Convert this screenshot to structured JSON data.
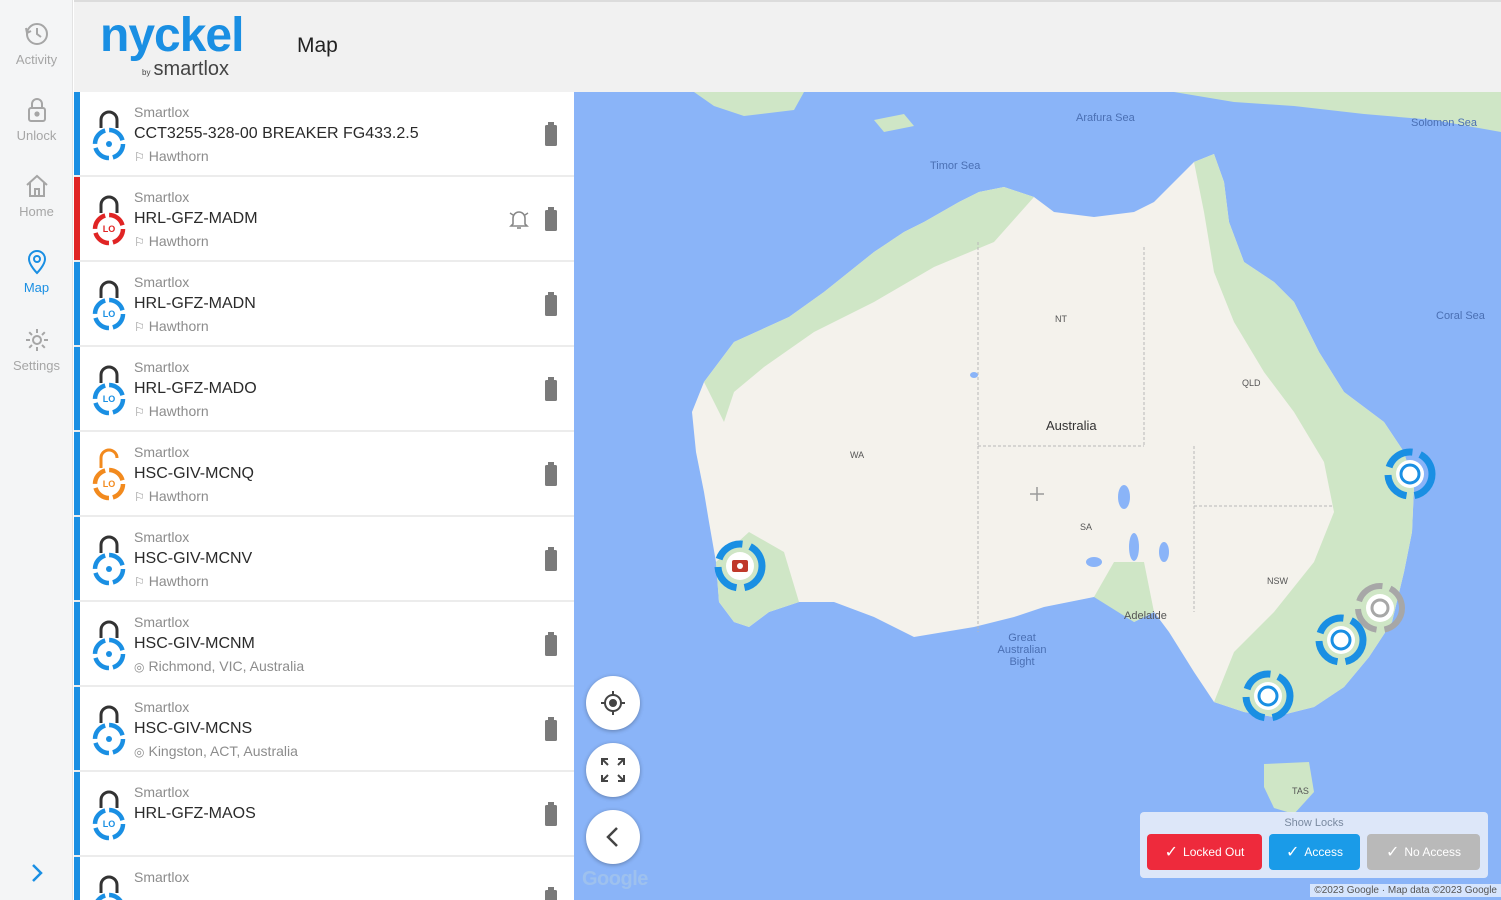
{
  "brand": {
    "name": "nyckel",
    "sub_prefix": "by",
    "sub": "smartlox"
  },
  "page_title": "Map",
  "nav": [
    {
      "label": "Activity",
      "icon": "history-icon",
      "active": false
    },
    {
      "label": "Unlock",
      "icon": "lock-icon",
      "active": false
    },
    {
      "label": "Home",
      "icon": "home-icon",
      "active": false
    },
    {
      "label": "Map",
      "icon": "map-pin-icon",
      "active": true
    },
    {
      "label": "Settings",
      "icon": "gear-icon",
      "active": false
    }
  ],
  "locks": [
    {
      "vendor": "Smartlox",
      "name": "CCT3255-328-00 BREAKER FG433.2.5",
      "location": "Hawthorn",
      "location_icon": "flag-icon",
      "status": "locked",
      "color": "#1a8fe3",
      "alarm": false
    },
    {
      "vendor": "Smartlox",
      "name": "HRL-GFZ-MADM",
      "location": "Hawthorn",
      "location_icon": "flag-icon",
      "status": "locked-out",
      "color": "#e02424",
      "alarm": true
    },
    {
      "vendor": "Smartlox",
      "name": "HRL-GFZ-MADN",
      "location": "Hawthorn",
      "location_icon": "flag-icon",
      "status": "locked-out",
      "color": "#1a8fe3",
      "alarm": false
    },
    {
      "vendor": "Smartlox",
      "name": "HRL-GFZ-MADO",
      "location": "Hawthorn",
      "location_icon": "flag-icon",
      "status": "locked-out",
      "color": "#1a8fe3",
      "alarm": false
    },
    {
      "vendor": "Smartlox",
      "name": "HSC-GIV-MCNQ",
      "location": "Hawthorn",
      "location_icon": "flag-icon",
      "status": "unlocked",
      "color": "#f28a1e",
      "alarm": false
    },
    {
      "vendor": "Smartlox",
      "name": "HSC-GIV-MCNV",
      "location": "Hawthorn",
      "location_icon": "flag-icon",
      "status": "locked",
      "color": "#1a8fe3",
      "alarm": false
    },
    {
      "vendor": "Smartlox",
      "name": "HSC-GIV-MCNM",
      "location": "Richmond, VIC, Australia",
      "location_icon": "pin-icon",
      "status": "locked",
      "color": "#1a8fe3",
      "alarm": false
    },
    {
      "vendor": "Smartlox",
      "name": "HSC-GIV-MCNS",
      "location": "Kingston, ACT, Australia",
      "location_icon": "pin-icon",
      "status": "locked",
      "color": "#1a8fe3",
      "alarm": false
    },
    {
      "vendor": "Smartlox",
      "name": "HRL-GFZ-MAOS",
      "location": "",
      "location_icon": "",
      "status": "locked-out",
      "color": "#1a8fe3",
      "alarm": false
    },
    {
      "vendor": "Smartlox",
      "name": "",
      "location": "",
      "location_icon": "",
      "status": "locked",
      "color": "#1a8fe3",
      "alarm": false
    }
  ],
  "map": {
    "labels": {
      "arafura": "Arafura Sea",
      "timor": "Timor Sea",
      "solomon": "Solomon Sea",
      "coral": "Coral Sea",
      "country": "Australia",
      "nt": "NT",
      "qld": "QLD",
      "wa": "WA",
      "sa": "SA",
      "nsw": "NSW",
      "adelaide": "Adelaide",
      "bight": "Great Australian Bight",
      "tas": "TAS"
    },
    "controls": {
      "locate": "crosshair-icon",
      "fullscreen": "expand-icon",
      "back": "chevron-left-icon"
    },
    "google": "Google",
    "attribution": "©2023 Google · Map data ©2023 Google"
  },
  "filters": {
    "title": "Show Locks",
    "locked_out": "Locked Out",
    "access": "Access",
    "no_access": "No Access",
    "colors": {
      "locked_out": "#ee2a3c",
      "access": "#1a9be8",
      "no_access": "#b9b9b9"
    }
  }
}
